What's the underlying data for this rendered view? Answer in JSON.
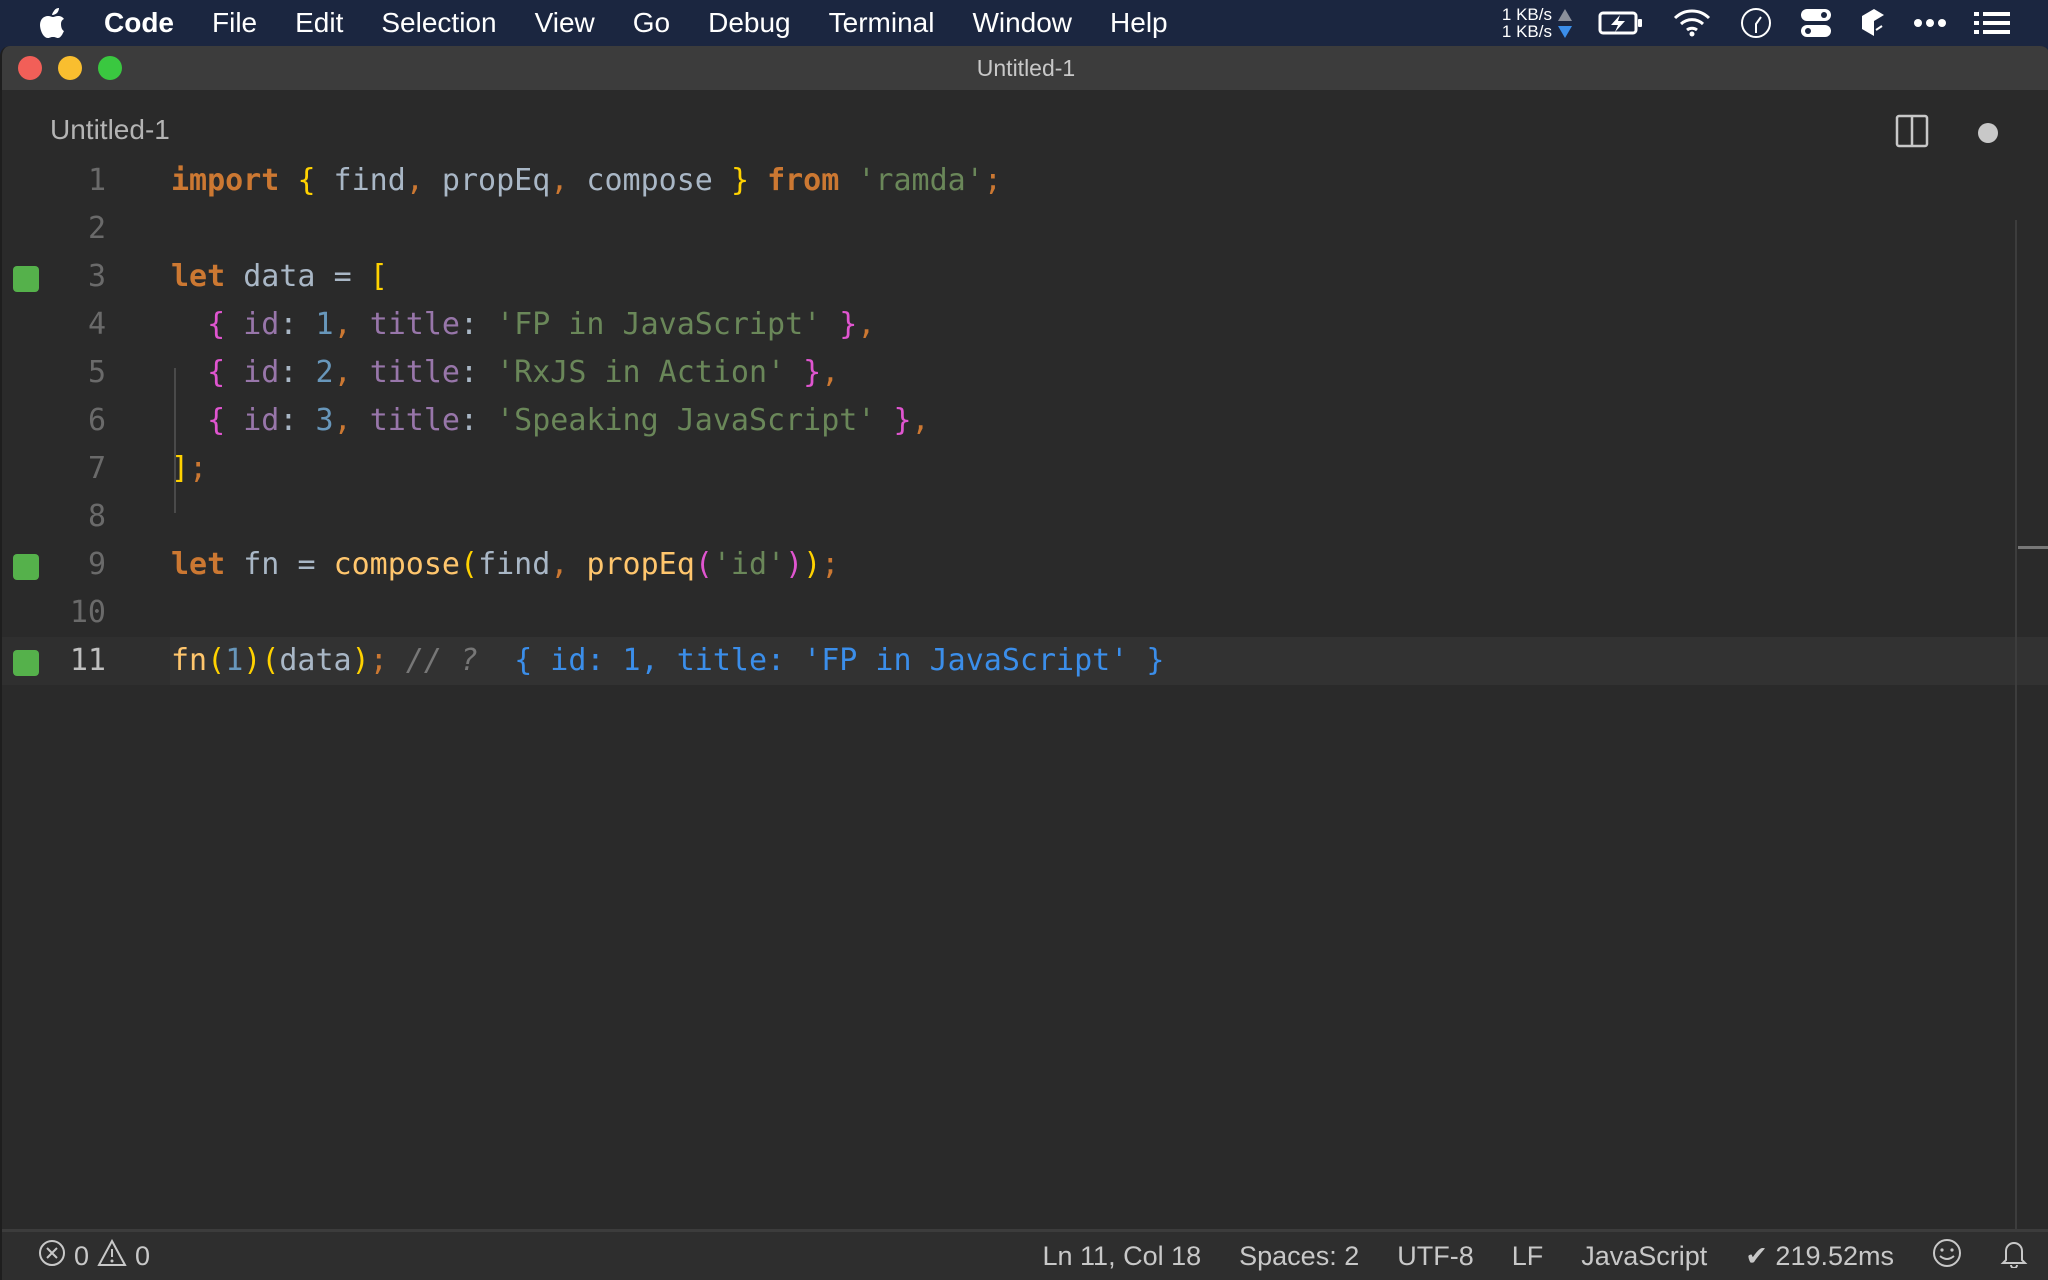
{
  "menubar": {
    "app_name": "Code",
    "items": [
      "File",
      "Edit",
      "Selection",
      "View",
      "Go",
      "Debug",
      "Terminal",
      "Window",
      "Help"
    ],
    "network": {
      "up": "1 KB/s",
      "down": "1 KB/s"
    },
    "status_icons": [
      "battery-charging-icon",
      "wifi-icon",
      "clock-icon",
      "toggle-icon",
      "app-icon",
      "more-icon",
      "list-icon"
    ]
  },
  "window": {
    "title": "Untitled-1",
    "tab": {
      "label": "Untitled-1",
      "dirty": true
    }
  },
  "editor": {
    "lines": [
      {
        "n": "1",
        "marker": false,
        "tokens": [
          [
            "kw",
            "import"
          ],
          [
            "op",
            " "
          ],
          [
            "br1",
            "{"
          ],
          [
            "id",
            " find"
          ],
          [
            "pun",
            ","
          ],
          [
            "id",
            " propEq"
          ],
          [
            "pun",
            ","
          ],
          [
            "id",
            " compose "
          ],
          [
            "br1",
            "}"
          ],
          [
            "op",
            " "
          ],
          [
            "kw",
            "from"
          ],
          [
            "op",
            " "
          ],
          [
            "str",
            "'ramda'"
          ],
          [
            "pun",
            ";"
          ]
        ]
      },
      {
        "n": "2",
        "marker": false,
        "tokens": []
      },
      {
        "n": "3",
        "marker": true,
        "tokens": [
          [
            "kw",
            "let"
          ],
          [
            "id",
            " data "
          ],
          [
            "op",
            "="
          ],
          [
            "op",
            " "
          ],
          [
            "br1",
            "["
          ]
        ]
      },
      {
        "n": "4",
        "marker": false,
        "tokens": [
          [
            "op",
            "  "
          ],
          [
            "br2",
            "{"
          ],
          [
            "op",
            " "
          ],
          [
            "prop",
            "id"
          ],
          [
            "op",
            ": "
          ],
          [
            "num",
            "1"
          ],
          [
            "pun",
            ","
          ],
          [
            "op",
            " "
          ],
          [
            "prop",
            "title"
          ],
          [
            "op",
            ": "
          ],
          [
            "str",
            "'FP in JavaScript'"
          ],
          [
            "op",
            " "
          ],
          [
            "br2",
            "}"
          ],
          [
            "pun",
            ","
          ]
        ]
      },
      {
        "n": "5",
        "marker": false,
        "tokens": [
          [
            "op",
            "  "
          ],
          [
            "br2",
            "{"
          ],
          [
            "op",
            " "
          ],
          [
            "prop",
            "id"
          ],
          [
            "op",
            ": "
          ],
          [
            "num",
            "2"
          ],
          [
            "pun",
            ","
          ],
          [
            "op",
            " "
          ],
          [
            "prop",
            "title"
          ],
          [
            "op",
            ": "
          ],
          [
            "str",
            "'RxJS in Action'"
          ],
          [
            "op",
            " "
          ],
          [
            "br2",
            "}"
          ],
          [
            "pun",
            ","
          ]
        ]
      },
      {
        "n": "6",
        "marker": false,
        "tokens": [
          [
            "op",
            "  "
          ],
          [
            "br2",
            "{"
          ],
          [
            "op",
            " "
          ],
          [
            "prop",
            "id"
          ],
          [
            "op",
            ": "
          ],
          [
            "num",
            "3"
          ],
          [
            "pun",
            ","
          ],
          [
            "op",
            " "
          ],
          [
            "prop",
            "title"
          ],
          [
            "op",
            ": "
          ],
          [
            "str",
            "'Speaking JavaScript'"
          ],
          [
            "op",
            " "
          ],
          [
            "br2",
            "}"
          ],
          [
            "pun",
            ","
          ]
        ]
      },
      {
        "n": "7",
        "marker": false,
        "tokens": [
          [
            "br1",
            "]"
          ],
          [
            "pun",
            ";"
          ]
        ]
      },
      {
        "n": "8",
        "marker": false,
        "tokens": []
      },
      {
        "n": "9",
        "marker": true,
        "tokens": [
          [
            "kw",
            "let"
          ],
          [
            "id",
            " fn "
          ],
          [
            "op",
            "="
          ],
          [
            "op",
            " "
          ],
          [
            "fnc",
            "compose"
          ],
          [
            "br1",
            "("
          ],
          [
            "id",
            "find"
          ],
          [
            "pun",
            ","
          ],
          [
            "op",
            " "
          ],
          [
            "fnc",
            "propEq"
          ],
          [
            "br2",
            "("
          ],
          [
            "str",
            "'id'"
          ],
          [
            "br2",
            ")"
          ],
          [
            "br1",
            ")"
          ],
          [
            "pun",
            ";"
          ]
        ]
      },
      {
        "n": "10",
        "marker": false,
        "tokens": []
      },
      {
        "n": "11",
        "marker": true,
        "current": true,
        "tokens": [
          [
            "fnc",
            "fn"
          ],
          [
            "br1",
            "("
          ],
          [
            "num",
            "1"
          ],
          [
            "br1",
            ")"
          ],
          [
            "br1",
            "("
          ],
          [
            "id",
            "data"
          ],
          [
            "br1",
            ")"
          ],
          [
            "pun",
            ";"
          ],
          [
            "op",
            " "
          ],
          [
            "cmt",
            "// ?"
          ],
          [
            "op",
            "  "
          ],
          [
            "res",
            "{ id: 1, title: 'FP in JavaScript' }"
          ]
        ]
      }
    ]
  },
  "statusbar": {
    "errors": "0",
    "warnings": "0",
    "cursor": "Ln 11, Col 18",
    "indent": "Spaces: 2",
    "encoding": "UTF-8",
    "eol": "LF",
    "language": "JavaScript",
    "timing": "✔ 219.52ms"
  }
}
